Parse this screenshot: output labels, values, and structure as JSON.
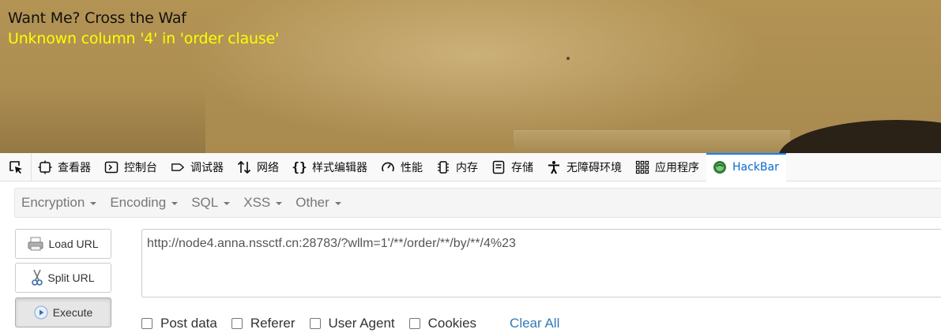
{
  "page": {
    "title": "Want Me? Cross the Waf",
    "error": "Unknown column '4' in 'order clause'"
  },
  "devtools": {
    "tabs": [
      {
        "label": "查看器",
        "icon": "inspector-icon"
      },
      {
        "label": "控制台",
        "icon": "console-icon"
      },
      {
        "label": "调试器",
        "icon": "debugger-icon"
      },
      {
        "label": "网络",
        "icon": "network-icon"
      },
      {
        "label": "样式编辑器",
        "icon": "style-editor-icon"
      },
      {
        "label": "性能",
        "icon": "performance-icon"
      },
      {
        "label": "内存",
        "icon": "memory-icon"
      },
      {
        "label": "存储",
        "icon": "storage-icon"
      },
      {
        "label": "无障碍环境",
        "icon": "accessibility-icon"
      },
      {
        "label": "应用程序",
        "icon": "application-icon"
      },
      {
        "label": "HackBar",
        "icon": "hackbar-icon",
        "selected": true
      }
    ]
  },
  "hackbar": {
    "menus": [
      "Encryption",
      "Encoding",
      "SQL",
      "XSS",
      "Other"
    ],
    "buttons": {
      "load_url": "Load URL",
      "split_url": "Split URL",
      "execute": "Execute"
    },
    "url": "http://node4.anna.nssctf.cn:28783/?wllm=1'/**/order/**/by/**/4%23",
    "options": [
      "Post data",
      "Referer",
      "User Agent",
      "Cookies"
    ],
    "clear_all": "Clear All"
  },
  "colors": {
    "error_text": "#ffff00",
    "accent": "#0a84ff",
    "link": "#337ab7"
  }
}
